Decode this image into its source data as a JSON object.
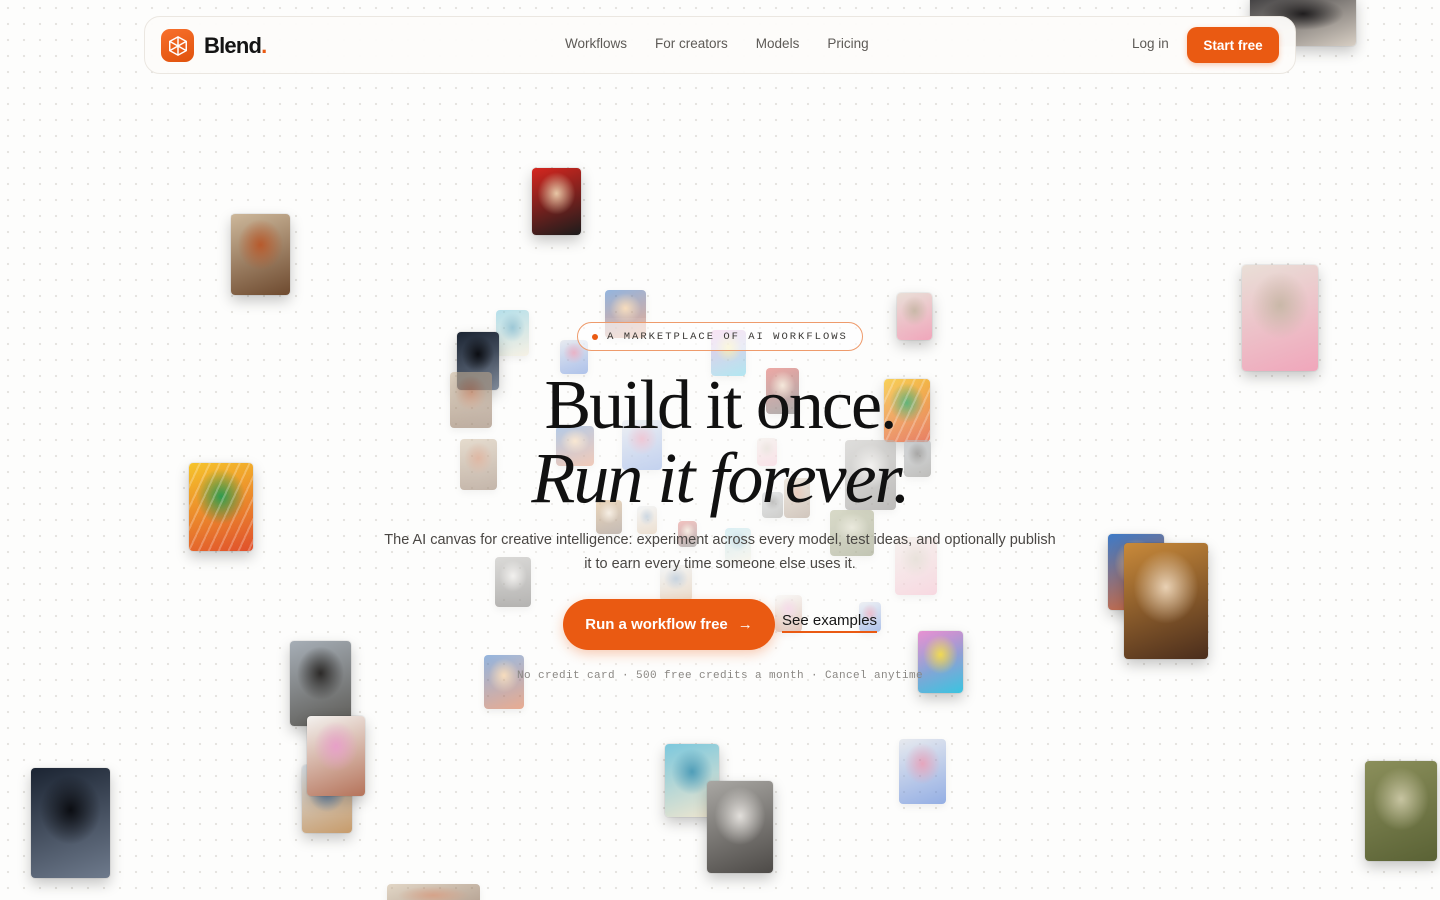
{
  "brand": {
    "name": "Blend",
    "dot": ".",
    "accent": "#ea5a12",
    "icon": "hexagon-cube-icon"
  },
  "nav": {
    "links": [
      "Workflows",
      "For creators",
      "Models",
      "Pricing"
    ],
    "login": "Log in",
    "start": "Start free"
  },
  "hero": {
    "tagline": "A MARKETPLACE OF AI WORKFLOWS",
    "headline_1": "Build it once.",
    "headline_2": "Run it forever.",
    "subtitle": "The AI canvas for creative intelligence: experiment across every model, test ideas, and optionally publish it to earn every time someone else uses it.",
    "cta_primary": "Run a workflow free",
    "cta_arrow": "→",
    "cta_secondary": "See examples",
    "footnote": "No credit card · 500 free credits a month · Cancel anytime"
  },
  "gallery": {
    "tiles": [
      {
        "name": "tile-fashion-couple-top",
        "c1": "#3b3a3c",
        "c2": "#d8cfc4",
        "c3": "#1f1d1e"
      },
      {
        "name": "tile-living-room",
        "c1": "#cdb89b",
        "c2": "#6e4a2f",
        "c3": "#b75a2c"
      },
      {
        "name": "tile-couple-red",
        "c1": "#d6261f",
        "c2": "#1c1c1c",
        "c3": "#e8c7a6"
      },
      {
        "name": "tile-pink-teacup",
        "c1": "#e9dfd7",
        "c2": "#f0a6bb",
        "c3": "#c9b8a8"
      },
      {
        "name": "tile-colorful-face",
        "c1": "#f6c42b",
        "c2": "#e04f2c",
        "c3": "#2e9c4f"
      },
      {
        "name": "tile-golden-eye",
        "c1": "#c98a3a",
        "c2": "#4a2d1c",
        "c3": "#e9d1b4"
      },
      {
        "name": "tile-desert-portrait",
        "c1": "#3d7ac7",
        "c2": "#d96a3a",
        "c3": "#f3c38b"
      },
      {
        "name": "tile-hiker-mountain",
        "c1": "#a6aeb6",
        "c2": "#5c5a55",
        "c3": "#2c2a28"
      },
      {
        "name": "tile-reclining-figure",
        "c1": "#f4f2ef",
        "c2": "#b5735a",
        "c3": "#e7a0c8"
      },
      {
        "name": "tile-blonde-portrait",
        "c1": "#dde4ea",
        "c2": "#c79b6a",
        "c3": "#5a7fa6"
      },
      {
        "name": "tile-spiral-stairs",
        "c1": "#1b2432",
        "c2": "#6e7a8c",
        "c3": "#0b0d12"
      },
      {
        "name": "tile-grey-suit-man",
        "c1": "#a9a7a3",
        "c2": "#4d4a47",
        "c3": "#e2dfdb"
      },
      {
        "name": "tile-surreal-arch",
        "c1": "#7cc8dd",
        "c2": "#f0e6cf",
        "c3": "#4f9db8"
      },
      {
        "name": "tile-blue-head",
        "c1": "#d6dbe5",
        "c2": "#3f6fd1",
        "c3": "#d35f8a"
      },
      {
        "name": "tile-moss-coat",
        "c1": "#8b8f5b",
        "c2": "#5a6235",
        "c3": "#c7c4a1"
      },
      {
        "name": "tile-pop-art-face",
        "c1": "#e37cc9",
        "c2": "#3ac4e0",
        "c3": "#f0d84b"
      }
    ]
  }
}
